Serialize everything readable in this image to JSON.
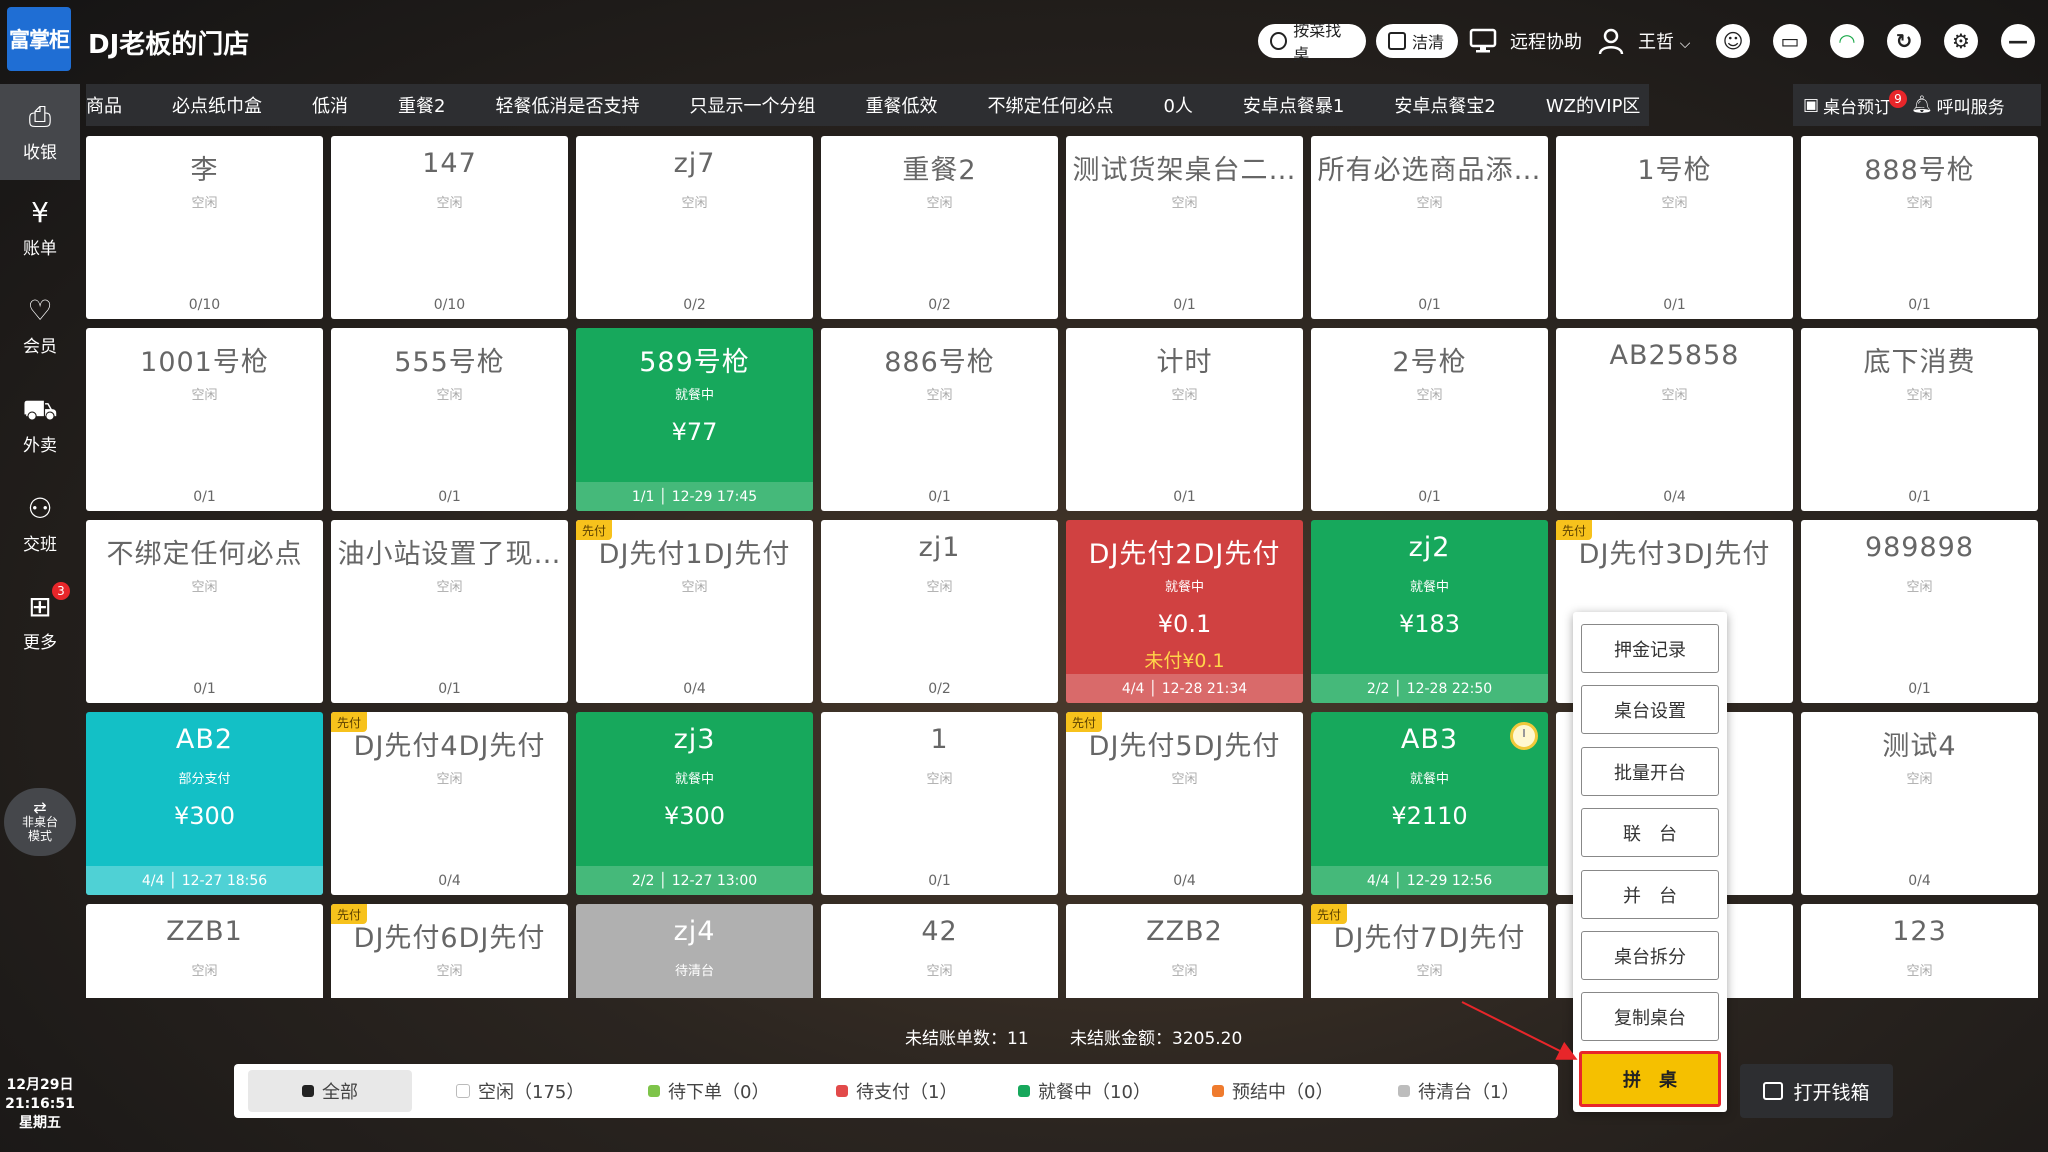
{
  "header": {
    "logo_text": "富掌柜",
    "store_name": "DJ老板的门店",
    "search_dish": "按菜找桌",
    "clean": "洁清",
    "remote_help": "远程协助",
    "user_name": "王哲"
  },
  "sidebar": {
    "items": [
      {
        "label": "收银",
        "icon": "cash-register-icon"
      },
      {
        "label": "账单",
        "icon": "bill-icon"
      },
      {
        "label": "会员",
        "icon": "member-icon"
      },
      {
        "label": "外卖",
        "icon": "delivery-icon"
      },
      {
        "label": "交班",
        "icon": "shift-icon"
      },
      {
        "label": "更多",
        "icon": "grid-icon",
        "badge": "3"
      }
    ],
    "mode_line1": "非桌台",
    "mode_line2": "模式",
    "date": "12月29日",
    "time": "21:16:51",
    "weekday": "星期五"
  },
  "tabs": [
    "商品",
    "必点纸巾盒",
    "低消",
    "重餐2",
    "轻餐低消是否支持",
    "只显示一个分组",
    "重餐低效",
    "不绑定任何必点",
    "0人",
    "安卓点餐暴1",
    "安卓点餐宝2",
    "WZ的VIP区"
  ],
  "right_actions": {
    "reserve": "桌台预订",
    "reserve_badge": "9",
    "call": "呼叫服务"
  },
  "tables": [
    {
      "name": "李",
      "status": "空闲",
      "count": "0/10",
      "style": "idle"
    },
    {
      "name": "147",
      "status": "空闲",
      "count": "0/10",
      "style": "idle"
    },
    {
      "name": "zj7",
      "status": "空闲",
      "count": "0/2",
      "style": "idle"
    },
    {
      "name": "重餐2",
      "status": "空闲",
      "count": "0/2",
      "style": "idle"
    },
    {
      "name": "测试货架桌台二…",
      "status": "空闲",
      "count": "0/1",
      "style": "idle"
    },
    {
      "name": "所有必选商品添…",
      "status": "空闲",
      "count": "0/1",
      "style": "idle"
    },
    {
      "name": "1号枪",
      "status": "空闲",
      "count": "0/1",
      "style": "idle"
    },
    {
      "name": "888号枪",
      "status": "空闲",
      "count": "0/1",
      "style": "idle"
    },
    {
      "name": "1001号枪",
      "status": "空闲",
      "count": "0/1",
      "style": "idle"
    },
    {
      "name": "555号枪",
      "status": "空闲",
      "count": "0/1",
      "style": "idle"
    },
    {
      "name": "589号枪",
      "status": "就餐中",
      "amount": "¥77",
      "footer": "1/1 │ 12-29 17:45",
      "style": "green"
    },
    {
      "name": "886号枪",
      "status": "空闲",
      "count": "0/1",
      "style": "idle"
    },
    {
      "name": "计时",
      "status": "空闲",
      "count": "0/1",
      "style": "idle"
    },
    {
      "name": "2号枪",
      "status": "空闲",
      "count": "0/1",
      "style": "idle"
    },
    {
      "name": "AB25858",
      "status": "空闲",
      "count": "0/4",
      "style": "idle"
    },
    {
      "name": "底下消费",
      "status": "空闲",
      "count": "0/1",
      "style": "idle"
    },
    {
      "name": "不绑定任何必点",
      "status": "空闲",
      "count": "0/1",
      "style": "idle"
    },
    {
      "name": "油小站设置了现…",
      "status": "空闲",
      "count": "0/1",
      "style": "idle"
    },
    {
      "name": "DJ先付1DJ先付",
      "status": "空闲",
      "count": "0/4",
      "style": "idle",
      "prepay": "先付"
    },
    {
      "name": "zj1",
      "status": "空闲",
      "count": "0/2",
      "style": "idle"
    },
    {
      "name": "DJ先付2DJ先付",
      "status": "就餐中",
      "amount": "¥0.1",
      "unpaid": "未付¥0.1",
      "footer": "4/4 │ 12-28 21:34",
      "style": "red"
    },
    {
      "name": "zj2",
      "status": "就餐中",
      "amount": "¥183",
      "footer": "2/2 │ 12-28 22:50",
      "style": "green"
    },
    {
      "name": "DJ先付3DJ先付",
      "status": "",
      "count": "",
      "style": "idle",
      "prepay": "先付"
    },
    {
      "name": "989898",
      "status": "空闲",
      "count": "0/1",
      "style": "idle"
    },
    {
      "name": "AB2",
      "status": "部分支付",
      "amount": "¥300",
      "footer": "4/4 │ 12-27 18:56",
      "style": "teal"
    },
    {
      "name": "DJ先付4DJ先付",
      "status": "空闲",
      "count": "0/4",
      "style": "idle",
      "prepay": "先付"
    },
    {
      "name": "zj3",
      "status": "就餐中",
      "amount": "¥300",
      "footer": "2/2 │ 12-27 13:00",
      "style": "green"
    },
    {
      "name": "1",
      "status": "空闲",
      "count": "0/1",
      "style": "idle"
    },
    {
      "name": "DJ先付5DJ先付",
      "status": "空闲",
      "count": "0/4",
      "style": "idle",
      "prepay": "先付"
    },
    {
      "name": "AB3",
      "status": "就餐中",
      "amount": "¥2110",
      "footer": "4/4 │ 12-29 12:56",
      "style": "green",
      "timer": true
    },
    {
      "name": "",
      "status": "",
      "count": "",
      "style": "idle"
    },
    {
      "name": "测试4",
      "status": "空闲",
      "count": "0/4",
      "style": "idle"
    },
    {
      "name": "ZZB1",
      "status": "空闲",
      "count": "",
      "style": "idle"
    },
    {
      "name": "DJ先付6DJ先付",
      "status": "空闲",
      "count": "",
      "style": "idle",
      "prepay": "先付"
    },
    {
      "name": "zj4",
      "status": "待清台",
      "count": "",
      "style": "gray"
    },
    {
      "name": "42",
      "status": "空闲",
      "count": "",
      "style": "idle"
    },
    {
      "name": "ZZB2",
      "status": "空闲",
      "count": "",
      "style": "idle"
    },
    {
      "name": "DJ先付7DJ先付",
      "status": "空闲",
      "count": "",
      "style": "idle",
      "prepay": "先付"
    },
    {
      "name": "",
      "status": "",
      "count": "",
      "style": "idle"
    },
    {
      "name": "123",
      "status": "空闲",
      "count": "",
      "style": "idle"
    }
  ],
  "context_menu": [
    "押金记录",
    "桌台设置",
    "批量开台",
    "联　台",
    "并　台",
    "桌台拆分",
    "复制桌台",
    "拼　桌"
  ],
  "summary": {
    "unsettled_orders": "未结账单数：11",
    "unsettled_amount": "未结账金额：3205.20"
  },
  "status_filters": [
    {
      "label": "全部",
      "color": "#222222"
    },
    {
      "label": "空闲（175）",
      "color": "#ffffff"
    },
    {
      "label": "待下单（0）",
      "color": "#7ec44a"
    },
    {
      "label": "待支付（1）",
      "color": "#e24a4a"
    },
    {
      "label": "就餐中（10）",
      "color": "#17a85c"
    },
    {
      "label": "预结中（0）",
      "color": "#ef7b2e"
    },
    {
      "label": "待清台（1）",
      "color": "#bdbdbd"
    }
  ],
  "open_cash_drawer": "打开钱箱"
}
